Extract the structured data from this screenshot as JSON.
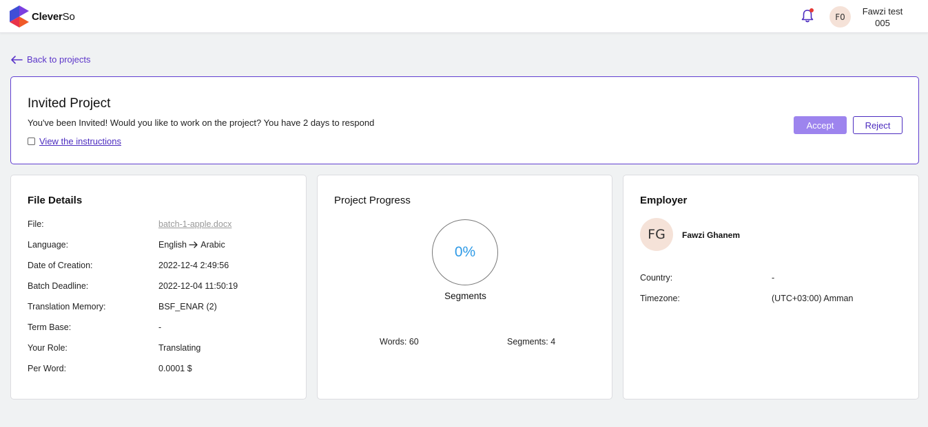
{
  "header": {
    "brand_a": "Clever",
    "brand_b": "So",
    "user_initials": "F0",
    "user_name_line1": "Fawzi test",
    "user_name_line2": "005",
    "accent": "#5b35c9",
    "notification_dot": "#e53935"
  },
  "back_link": "Back to projects",
  "invite": {
    "title": "Invited Project",
    "message": "You've been Invited! Would you like to work on the project? You have 2 days to respond",
    "instructions_link": "View the instructions",
    "accept_label": "Accept",
    "reject_label": "Reject"
  },
  "file_details": {
    "title": "File Details",
    "rows": [
      {
        "label": "File:",
        "value": "batch-1-apple.docx"
      },
      {
        "label": "Language:",
        "value_from": "English",
        "value_to": "Arabic"
      },
      {
        "label": "Date of Creation:",
        "value": "2022-12-4 2:49:56"
      },
      {
        "label": "Batch Deadline:",
        "value": "2022-12-04 11:50:19"
      },
      {
        "label": "Translation Memory:",
        "value": "BSF_ENAR (2)"
      },
      {
        "label": "Term Base:",
        "value": "-"
      },
      {
        "label": "Your Role:",
        "value": "Translating"
      },
      {
        "label": "Per Word:",
        "value": "0.0001 $"
      }
    ]
  },
  "project_progress": {
    "title": "Project Progress",
    "percent": "0%",
    "ring_label": "Segments",
    "words": "Words: 60",
    "segments": "Segments: 4"
  },
  "employer": {
    "title": "Employer",
    "initials": "FG",
    "name": "Fawzi Ghanem",
    "country_label": "Country:",
    "country_value": "-",
    "timezone_label": "Timezone:",
    "timezone_value": "(UTC+03:00) Amman"
  }
}
